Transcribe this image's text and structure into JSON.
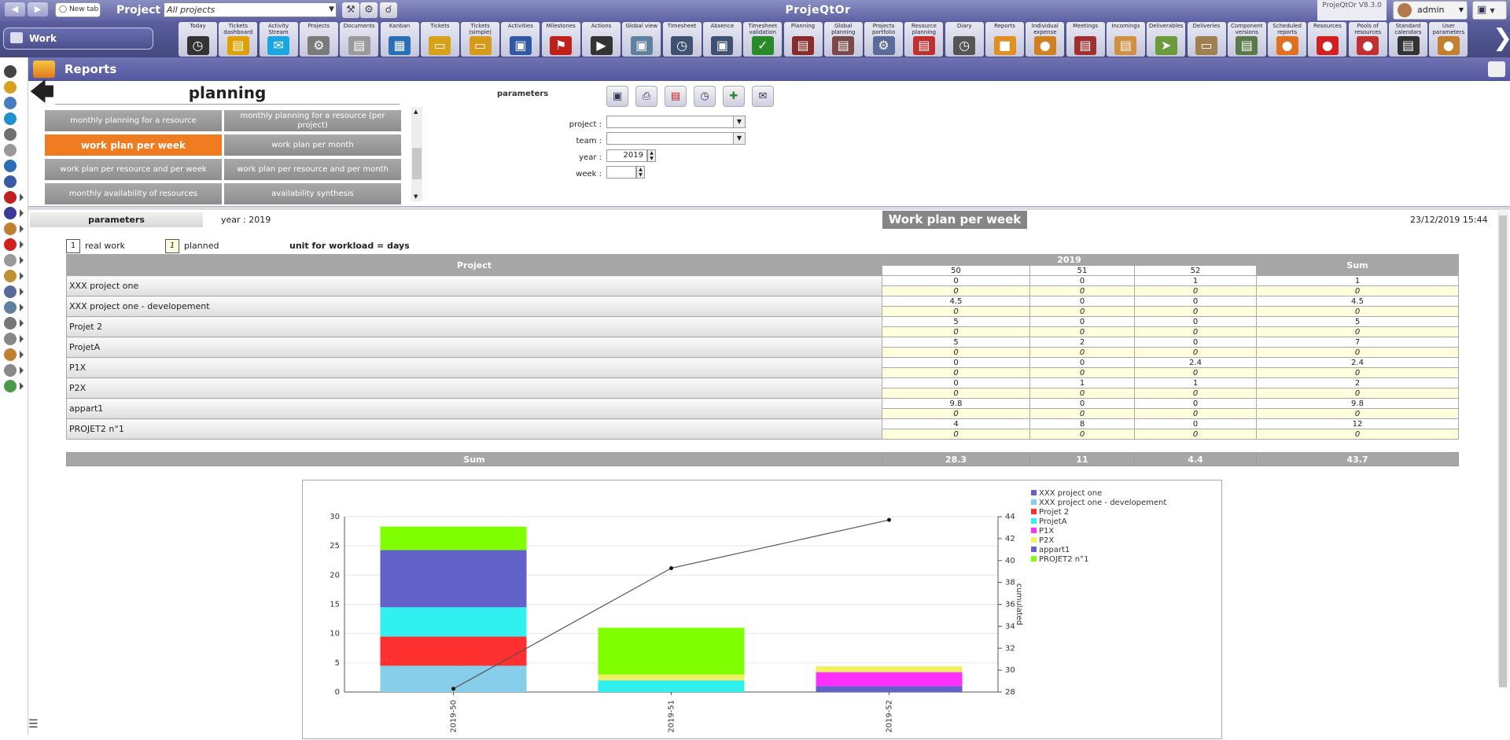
{
  "topbar": {
    "project_label": "Project :",
    "project_value": "All projects",
    "new_tab": "New tab",
    "app_title": "ProjeQtOr",
    "version": "ProjeQtOr V8.3.0",
    "user": "admin"
  },
  "menubar": {
    "work_label": "Work",
    "items": [
      {
        "label": "Today",
        "color": "#333"
      },
      {
        "label": "Tickets dashboard",
        "color": "#e0a000"
      },
      {
        "label": "Activity Stream",
        "color": "#1aa6e0"
      },
      {
        "label": "Projects",
        "color": "#7a7a7a"
      },
      {
        "label": "Documents",
        "color": "#9a9a9a"
      },
      {
        "label": "Kanban",
        "color": "#2a6fb5"
      },
      {
        "label": "Tickets",
        "color": "#d7a11a"
      },
      {
        "label": "Tickets (simple)",
        "color": "#d79a1a"
      },
      {
        "label": "Activities",
        "color": "#3058a5"
      },
      {
        "label": "Milestones",
        "color": "#c0201a"
      },
      {
        "label": "Actions",
        "color": "#333"
      },
      {
        "label": "Global view",
        "color": "#6080a0"
      },
      {
        "label": "Timesheet",
        "color": "#405070"
      },
      {
        "label": "Absence",
        "color": "#405070"
      },
      {
        "label": "Timesheet validation",
        "color": "#2a8a2a"
      },
      {
        "label": "Planning",
        "color": "#8a2a2a"
      },
      {
        "label": "Global planning",
        "color": "#7a4a4a"
      },
      {
        "label": "Projects portfolio",
        "color": "#5a6a9a"
      },
      {
        "label": "Resource planning",
        "color": "#c03030"
      },
      {
        "label": "Diary",
        "color": "#555"
      },
      {
        "label": "Reports",
        "color": "#e09020"
      },
      {
        "label": "Individual expense",
        "color": "#d08020"
      },
      {
        "label": "Meetings",
        "color": "#a03030"
      },
      {
        "label": "Incomings",
        "color": "#d09040"
      },
      {
        "label": "Deliverables",
        "color": "#6a9a3a"
      },
      {
        "label": "Deliveries",
        "color": "#a08050"
      },
      {
        "label": "Component versions planning",
        "color": "#5a7a4a"
      },
      {
        "label": "Scheduled reports",
        "color": "#e07020"
      },
      {
        "label": "Resources",
        "color": "#d02020"
      },
      {
        "label": "Pools of resources",
        "color": "#c03030"
      },
      {
        "label": "Standard calendars",
        "color": "#333"
      },
      {
        "label": "User parameters",
        "color": "#c08030"
      }
    ]
  },
  "reports": {
    "title": "Reports",
    "category": "planning",
    "report_buttons": [
      {
        "label": "monthly planning for a resource",
        "active": false
      },
      {
        "label": "monthly planning for a resource (per project)",
        "active": false
      },
      {
        "label": "work plan per week",
        "active": true
      },
      {
        "label": "work plan per month",
        "active": false
      },
      {
        "label": "work plan per resource and per week",
        "active": false
      },
      {
        "label": "work plan per resource and per month",
        "active": false
      },
      {
        "label": "monthly availability of resources",
        "active": false
      },
      {
        "label": "availability synthesis",
        "active": false
      }
    ]
  },
  "params": {
    "title": "parameters",
    "project_label": "project :",
    "project_value": "",
    "team_label": "team :",
    "team_value": "",
    "year_label": "year :",
    "year_value": "2019",
    "week_label": "week :",
    "week_value": ""
  },
  "report": {
    "params_button": "parameters",
    "year_text": "year : 2019",
    "title": "Work plan per week",
    "date": "23/12/2019 15:44",
    "legend_real_box": "1",
    "legend_real": "real work",
    "legend_planned_box": "1",
    "legend_planned": "planned",
    "unit_note": "unit for workload = days"
  },
  "table": {
    "project_header": "Project",
    "year_header": "2019",
    "sum_header": "Sum",
    "weeks": [
      "50",
      "51",
      "52"
    ],
    "rows": [
      {
        "name": "XXX project one",
        "real": [
          "0",
          "0",
          "1"
        ],
        "real_sum": "1",
        "planned": [
          "0",
          "0",
          "0"
        ],
        "planned_sum": "0"
      },
      {
        "name": "XXX project one - developement",
        "real": [
          "4.5",
          "0",
          "0"
        ],
        "real_sum": "4.5",
        "planned": [
          "0",
          "0",
          "0"
        ],
        "planned_sum": "0"
      },
      {
        "name": "Projet 2",
        "real": [
          "5",
          "0",
          "0"
        ],
        "real_sum": "5",
        "planned": [
          "0",
          "0",
          "0"
        ],
        "planned_sum": "0"
      },
      {
        "name": "ProjetA",
        "real": [
          "5",
          "2",
          "0"
        ],
        "real_sum": "7",
        "planned": [
          "0",
          "0",
          "0"
        ],
        "planned_sum": "0"
      },
      {
        "name": "P1X",
        "real": [
          "0",
          "0",
          "2.4"
        ],
        "real_sum": "2.4",
        "planned": [
          "0",
          "0",
          "0"
        ],
        "planned_sum": "0"
      },
      {
        "name": "P2X",
        "real": [
          "0",
          "1",
          "1"
        ],
        "real_sum": "2",
        "planned": [
          "0",
          "0",
          "0"
        ],
        "planned_sum": "0"
      },
      {
        "name": "appart1",
        "real": [
          "9.8",
          "0",
          "0"
        ],
        "real_sum": "9.8",
        "planned": [
          "0",
          "0",
          "0"
        ],
        "planned_sum": "0"
      },
      {
        "name": "PROJET2 n°1",
        "real": [
          "4",
          "8",
          "0"
        ],
        "real_sum": "12",
        "planned": [
          "0",
          "0",
          "0"
        ],
        "planned_sum": "0"
      }
    ],
    "sum_label": "Sum",
    "sums": [
      "28.3",
      "11",
      "4.4"
    ],
    "total": "43.7"
  },
  "chart_data": {
    "type": "bar",
    "stacked": true,
    "categories": [
      "2019-50",
      "2019-51",
      "2019-52"
    ],
    "series": [
      {
        "name": "XXX project one",
        "color": "#6262c8",
        "values": [
          0,
          0,
          1
        ]
      },
      {
        "name": "XXX project one - developement",
        "color": "#87ceeb",
        "values": [
          4.5,
          0,
          0
        ]
      },
      {
        "name": "Projet 2",
        "color": "#ff3030",
        "values": [
          5,
          0,
          0
        ]
      },
      {
        "name": "ProjetA",
        "color": "#30f0f0",
        "values": [
          5,
          2,
          0
        ]
      },
      {
        "name": "P1X",
        "color": "#ff30ff",
        "values": [
          0,
          0,
          2.4
        ]
      },
      {
        "name": "P2X",
        "color": "#f0f060",
        "values": [
          0,
          1,
          1
        ]
      },
      {
        "name": "appart1",
        "color": "#6262c8",
        "values": [
          9.8,
          0,
          0
        ]
      },
      {
        "name": "PROJET2 n°1",
        "color": "#80ff00",
        "values": [
          4,
          8,
          0
        ]
      }
    ],
    "line": {
      "name": "cumulated",
      "values": [
        28.3,
        39.3,
        43.7
      ]
    },
    "ylim": [
      0,
      30
    ],
    "y_ticks": [
      0,
      5,
      10,
      15,
      20,
      25,
      30
    ],
    "y2lim": [
      28,
      44
    ],
    "y2_ticks": [
      28,
      30,
      32,
      34,
      36,
      38,
      40,
      42,
      44
    ],
    "y2label": "cumulated",
    "legend": "top-right"
  }
}
